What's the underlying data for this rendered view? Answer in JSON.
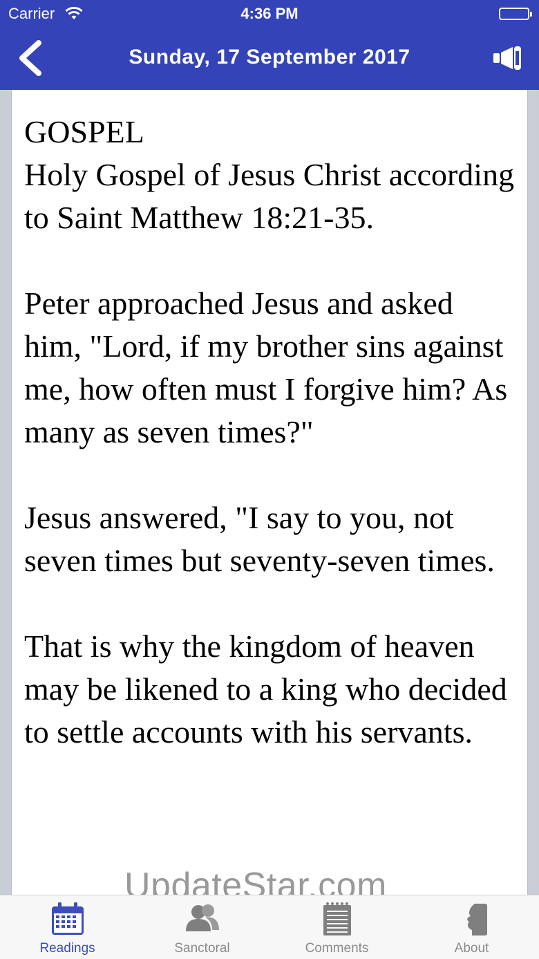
{
  "status_bar": {
    "carrier": "Carrier",
    "time": "4:36 PM",
    "wifi_icon": "wifi-icon",
    "battery_icon": "battery-icon"
  },
  "nav": {
    "title": "Sunday, 17 September 2017",
    "back_icon": "chevron-left-icon",
    "speaker_icon": "megaphone-icon"
  },
  "reading": {
    "section": "GOSPEL",
    "reference": "Holy Gospel of Jesus Christ according to Saint Matthew 18:21-35.",
    "paragraphs": [
      "Peter approached Jesus and asked him, \"Lord, if my brother sins against me, how often must I forgive him? As many as seven times?\"",
      "Jesus answered, \"I say to you, not seven times but seventy-seven times.",
      "That is why the kingdom of heaven may be likened to a king who decided to settle accounts with his servants."
    ]
  },
  "watermark": "UpdateStar.com",
  "tabs": [
    {
      "label": "Readings",
      "icon": "calendar-icon",
      "active": true
    },
    {
      "label": "Sanctoral",
      "icon": "people-icon",
      "active": false
    },
    {
      "label": "Comments",
      "icon": "notepad-icon",
      "active": false
    },
    {
      "label": "About",
      "icon": "profile-icon",
      "active": false
    }
  ],
  "colors": {
    "header": "#3443b8",
    "active_tab": "#3d4dbb",
    "inactive_tab": "#8a8a8a"
  }
}
